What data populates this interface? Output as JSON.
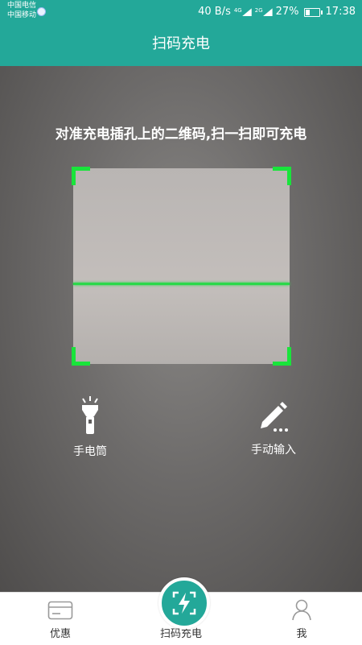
{
  "status_bar": {
    "carrier1": "中国电信",
    "carrier2": "中国移动",
    "network_speed": "40 B/s",
    "signal1_label": "4G",
    "signal2_label": "2G",
    "battery": "27%",
    "time": "17:38"
  },
  "header": {
    "title": "扫码充电"
  },
  "scanner": {
    "hint": "对准充电插孔上的二维码,扫一扫即可充电"
  },
  "actions": {
    "flashlight_label": "手电筒",
    "manual_input_label": "手动输入"
  },
  "bottom_nav": {
    "discount_label": "优惠",
    "scan_label": "扫码充电",
    "me_label": "我"
  },
  "colors": {
    "accent": "#23a899",
    "scan_green": "#19e43b"
  },
  "icons": {
    "flashlight": "flashlight-icon",
    "manual": "pencil-icon",
    "discount": "card-icon",
    "scan": "lightning-scan-icon",
    "me": "user-icon"
  }
}
